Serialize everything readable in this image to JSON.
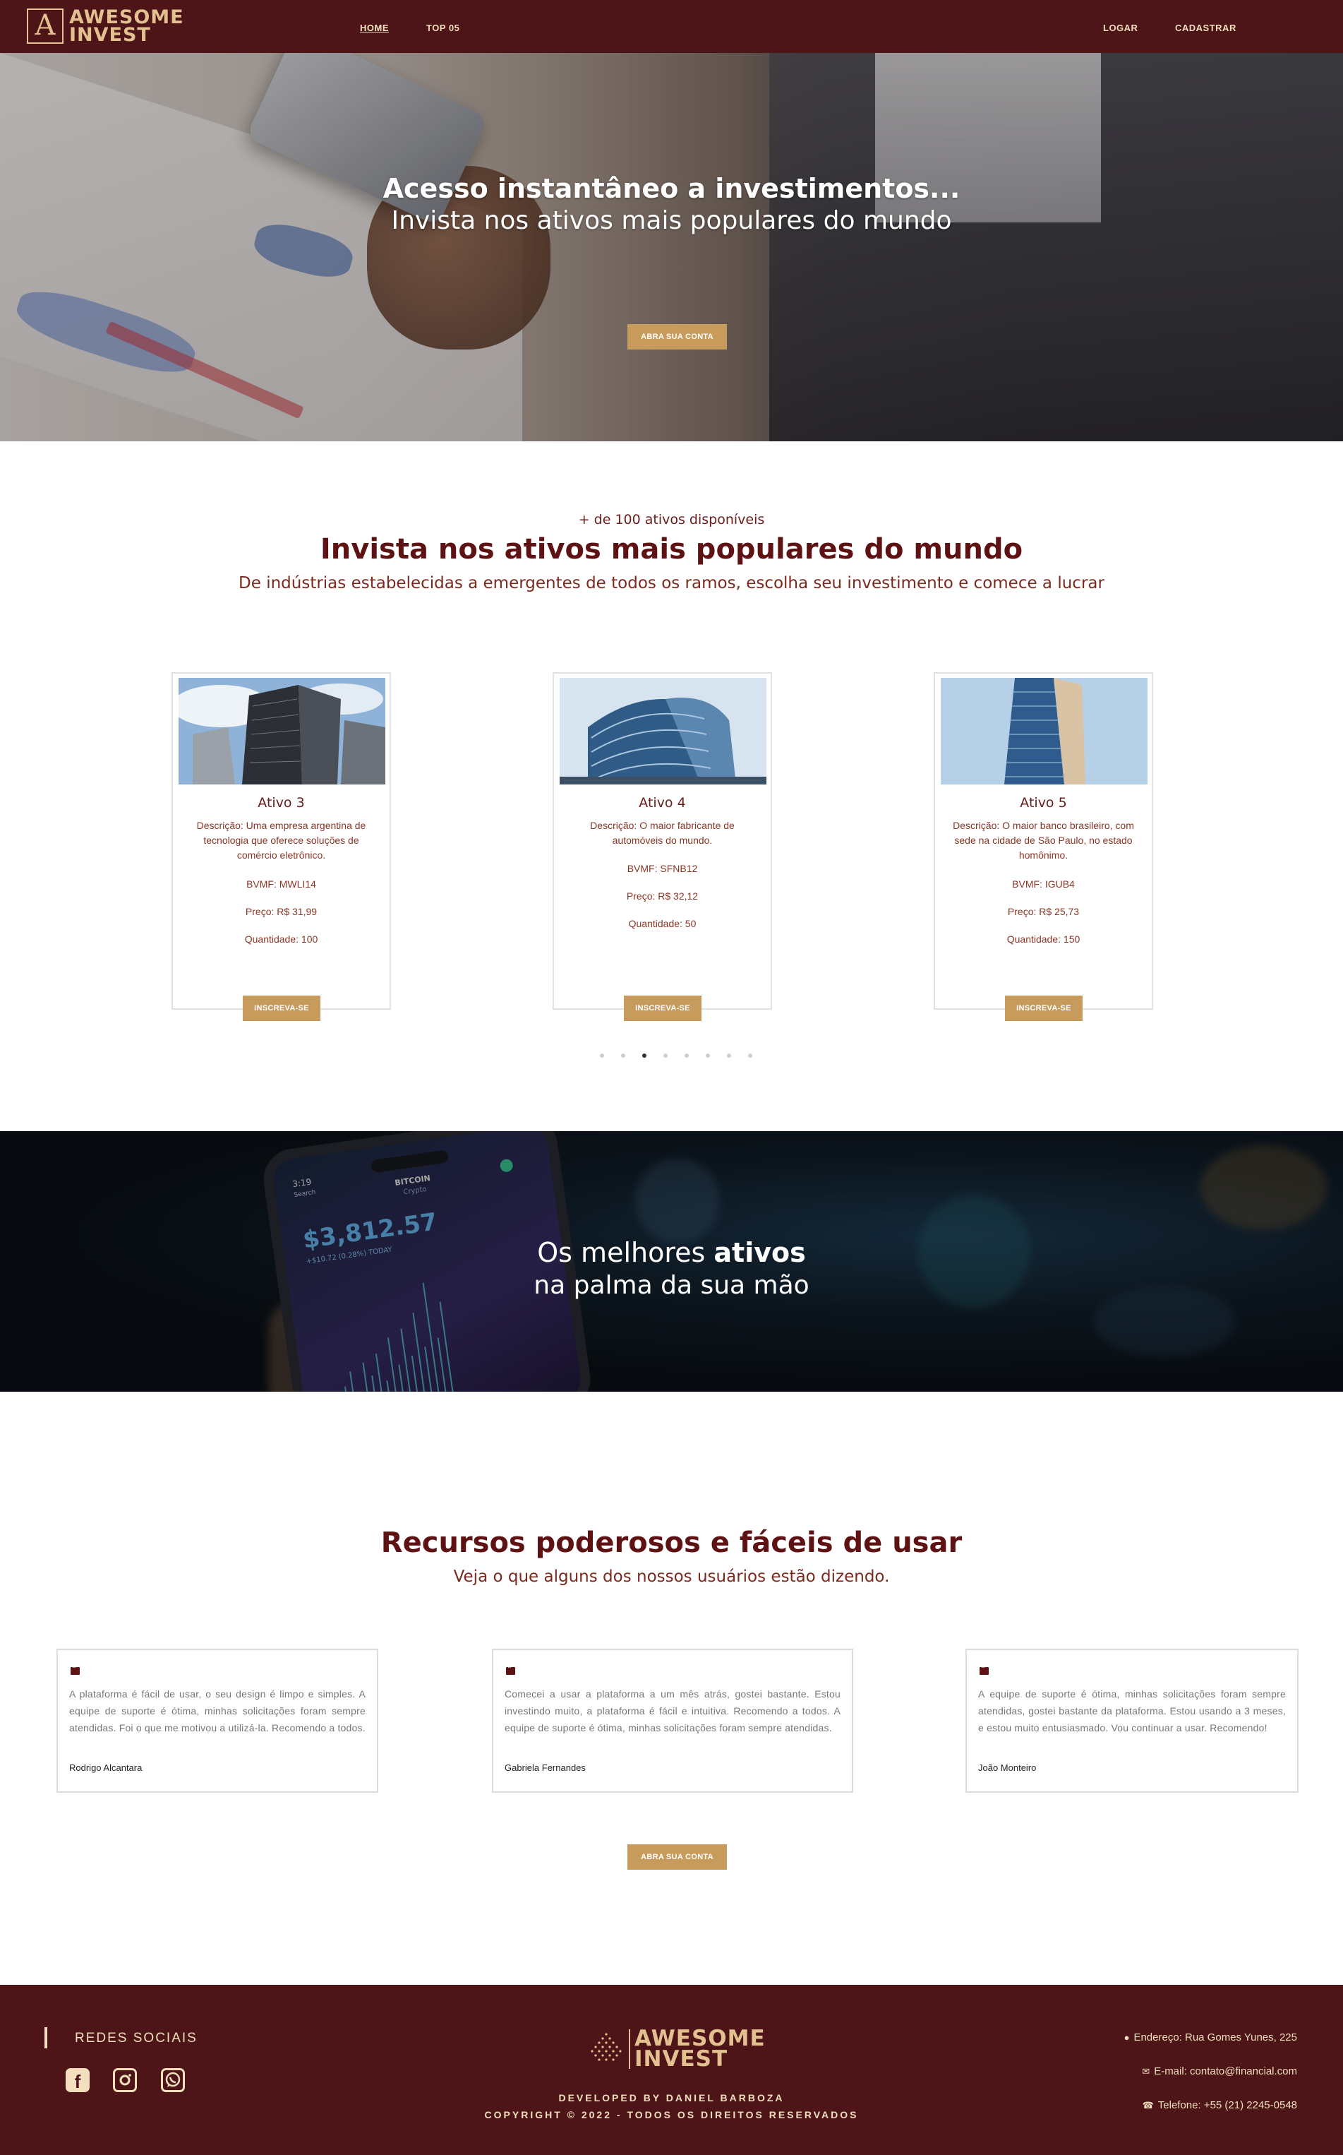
{
  "brand": {
    "line1": "AWESOME",
    "line2": "INVEST",
    "mark": "A"
  },
  "nav": {
    "links": [
      {
        "label": "HOME",
        "active": true
      },
      {
        "label": "TOP 05",
        "active": false
      }
    ],
    "login": "LOGAR",
    "signup": "CADASTRAR"
  },
  "hero": {
    "title": "Acesso instantâneo a investimentos...",
    "subtitle": "Invista nos ativos mais populares do mundo",
    "cta": "ABRA SUA CONTA"
  },
  "assets_section": {
    "kicker": "+ de 100 ativos disponíveis",
    "title": "Invista nos ativos mais populares do mundo",
    "subtitle": "De indústrias estabelecidas a emergentes de todos os ramos, escolha seu investimento e comece a lucrar",
    "cards": [
      {
        "name": "Ativo 3",
        "description": "Descrição: Uma empresa argentina de tecnologia que oferece soluções de comércio eletrônico.",
        "code": "BVMF: MWLI14",
        "price": "Preço: R$ 31,99",
        "quantity": "Quantidade: 100",
        "button": "INSCREVA-SE"
      },
      {
        "name": "Ativo 4",
        "description": "Descrição: O maior fabricante de automóveis do mundo.",
        "code": "BVMF: SFNB12",
        "price": "Preço: R$ 32,12",
        "quantity": "Quantidade: 50",
        "button": "INSCREVA-SE"
      },
      {
        "name": "Ativo 5",
        "description": "Descrição: O maior banco brasileiro, com sede na cidade de São Paulo, no estado homônimo.",
        "code": "BVMF: IGUB4",
        "price": "Preço: R$ 25,73",
        "quantity": "Quantidade: 150",
        "button": "INSCREVA-SE"
      }
    ],
    "carousel_dots": 8,
    "carousel_active": 3
  },
  "banner": {
    "line1_normal": "Os melhores ",
    "line1_bold": "ativos",
    "line2": "na palma da sua mão",
    "phone_price": "$3,812.57",
    "phone_coin": "BITCOIN",
    "phone_sub": "Crypto",
    "phone_change": "+$10.72 (0.28%) TODAY",
    "phone_time": "3:19",
    "phone_back": "Search"
  },
  "features": {
    "title": "Recursos poderosos e fáceis de usar",
    "subtitle": "Veja o que alguns dos nossos usuários estão dizendo.",
    "testimonials": [
      {
        "text": "A plataforma é fácil de usar, o seu design é limpo e simples. A equipe de suporte é ótima, minhas solicitações foram sempre atendidas. Foi o que me motivou a utilizá-la. Recomendo a todos.",
        "author": "Rodrigo Alcantara"
      },
      {
        "text": "Comecei a usar a plataforma a um mês atrás, gostei bastante. Estou investindo muito, a plataforma é fácil e intuitiva. Recomendo a todos. A equipe de suporte é ótima, minhas solicitações foram sempre atendidas.",
        "author": "Gabriela Fernandes"
      },
      {
        "text": "A equipe de suporte é ótima, minhas solicitações foram sempre atendidas, gostei bastante da plataforma. Estou usando a 3 meses, e estou muito entusiasmado. Vou continuar a usar. Recomendo!",
        "author": "João Monteiro"
      }
    ],
    "cta": "ABRA SUA CONTA"
  },
  "footer": {
    "social_title": "REDES SOCIAIS",
    "social_icons": [
      "facebook-icon",
      "instagram-icon",
      "whatsapp-icon"
    ],
    "logo_line1": "AWESOME",
    "logo_line2": "INVEST",
    "developed": "DEVELOPED BY DANIEL BARBOZA",
    "copyright": "COPYRIGHT © 2022 - TODOS OS DIREITOS RESERVADOS",
    "address": "Endereço: Rua Gomes Yunes, 225",
    "email": "E-mail: contato@financial.com",
    "phone": "Telefone: +55 (21) 2245-0548"
  },
  "colors": {
    "maroon": "#4d1517",
    "gold": "#c69b5c",
    "cream": "#f3dfbd",
    "title": "#5e1214"
  }
}
